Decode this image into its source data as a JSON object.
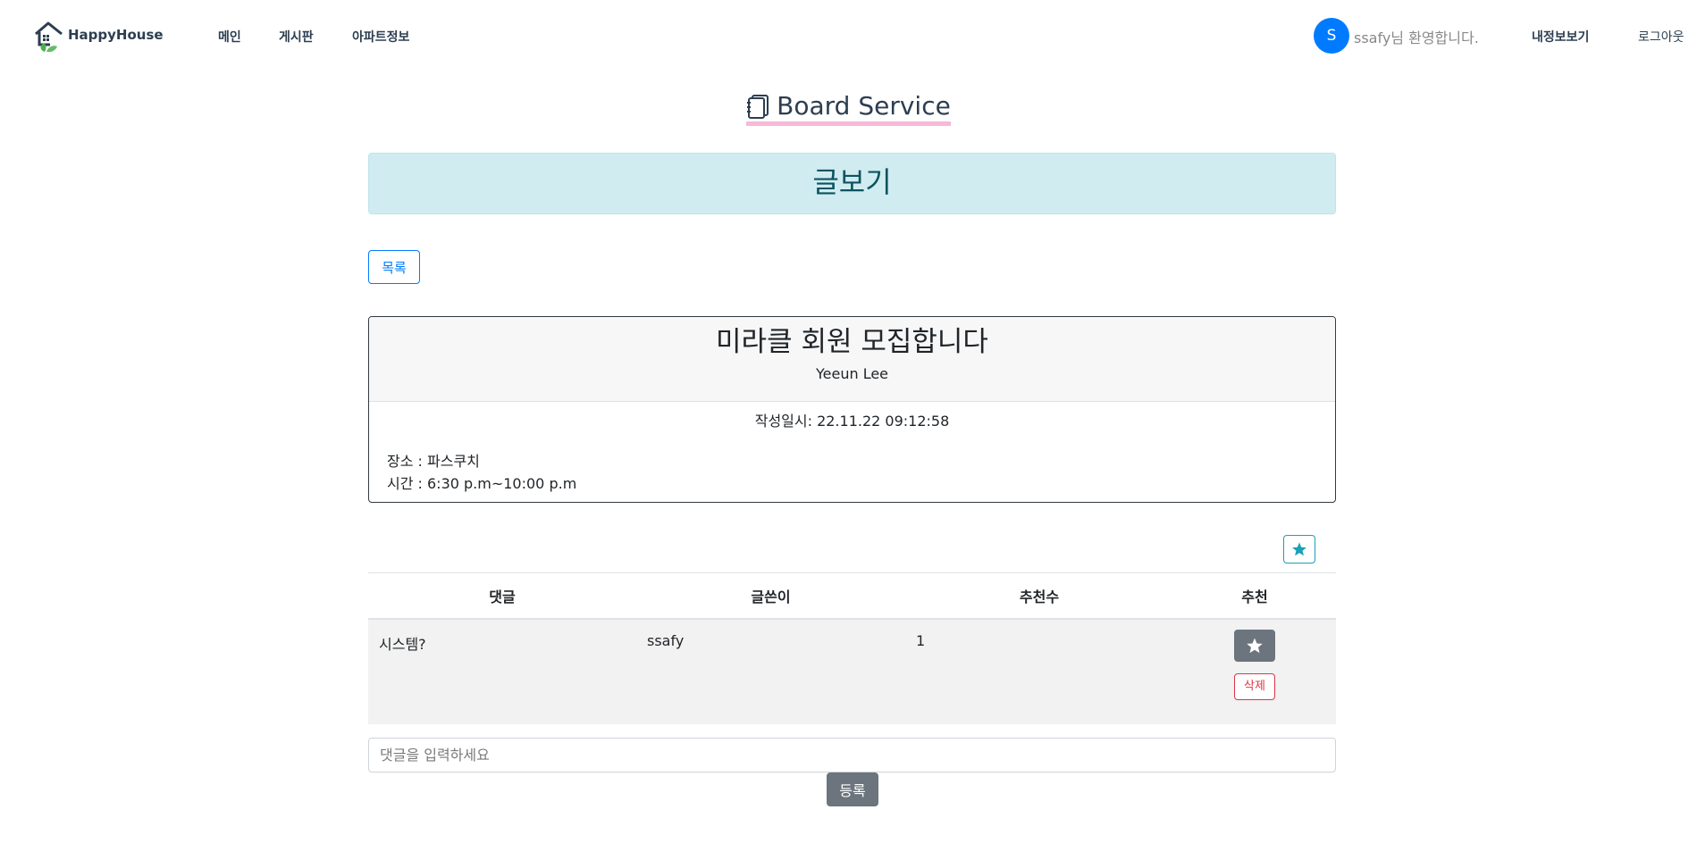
{
  "navbar": {
    "brand": "HappyHouse",
    "links": [
      {
        "label": "메인"
      },
      {
        "label": "게시판"
      },
      {
        "label": "아파트정보"
      }
    ],
    "user": {
      "avatar_initial": "S",
      "name": "ssafy",
      "welcome_suffix": "님 환영합니다.",
      "mypage": "내정보보기",
      "logout": "로그아웃"
    }
  },
  "page": {
    "title": "Board Service",
    "subtitle": "글보기",
    "list_button": "목록"
  },
  "article": {
    "title": "미라클 회원 모집합니다",
    "author": "Yeeun Lee",
    "date_label": "작성일시: 22.11.22 09:12:58",
    "content_lines": [
      "장소 : 파스쿠치",
      "시간 : 6:30 p.m~10:00 p.m"
    ]
  },
  "comments": {
    "headers": [
      "댓글",
      "글쓴이",
      "추천수",
      "추천"
    ],
    "rows": [
      {
        "text": "시스템?",
        "writer": "ssafy",
        "likes": "1",
        "delete_label": "삭제"
      }
    ],
    "input_placeholder": "댓글을 입력하세요",
    "submit_label": "등록"
  },
  "colors": {
    "primary": "#007bff",
    "info": "#17a2b8",
    "secondary": "#6c757d",
    "danger": "#dc3545",
    "alert_bg": "#d1ecf1",
    "title_underline": "#f6b9d8"
  }
}
